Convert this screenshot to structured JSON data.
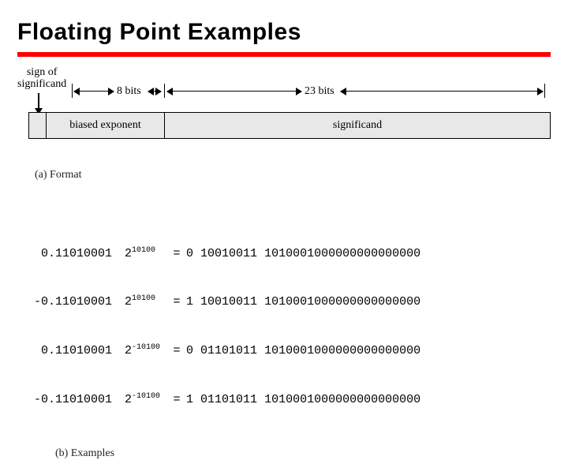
{
  "title": "Floating Point Examples",
  "diagram": {
    "sign_label_l1": "sign of",
    "sign_label_l2": "significand",
    "exp_bits_label": "8 bits",
    "sig_bits_label": "23 bits",
    "exp_field": "biased exponent",
    "sig_field": "significand",
    "caption": "(a) Format"
  },
  "examples": {
    "rows": [
      {
        "m": " 0.11010001",
        "b": "2",
        "e": "10100",
        "s": "0",
        "exp": "10010011",
        "sig": "1010001000000000000000"
      },
      {
        "m": "-0.11010001",
        "b": "2",
        "e": "10100",
        "s": "1",
        "exp": "10010011",
        "sig": "1010001000000000000000"
      },
      {
        "m": " 0.11010001",
        "b": "2",
        "e": "-10100",
        "s": "0",
        "exp": "01101011",
        "sig": "1010001000000000000000"
      },
      {
        "m": "-0.11010001",
        "b": "2",
        "e": "-10100",
        "s": "1",
        "exp": "01101011",
        "sig": "1010001000000000000000"
      }
    ],
    "caption": "(b) Examples"
  },
  "chart_data": {
    "type": "table",
    "title": "IEEE 754 single-precision format",
    "fields": [
      {
        "name": "sign",
        "bits": 1
      },
      {
        "name": "biased exponent",
        "bits": 8
      },
      {
        "name": "significand",
        "bits": 23
      }
    ]
  }
}
